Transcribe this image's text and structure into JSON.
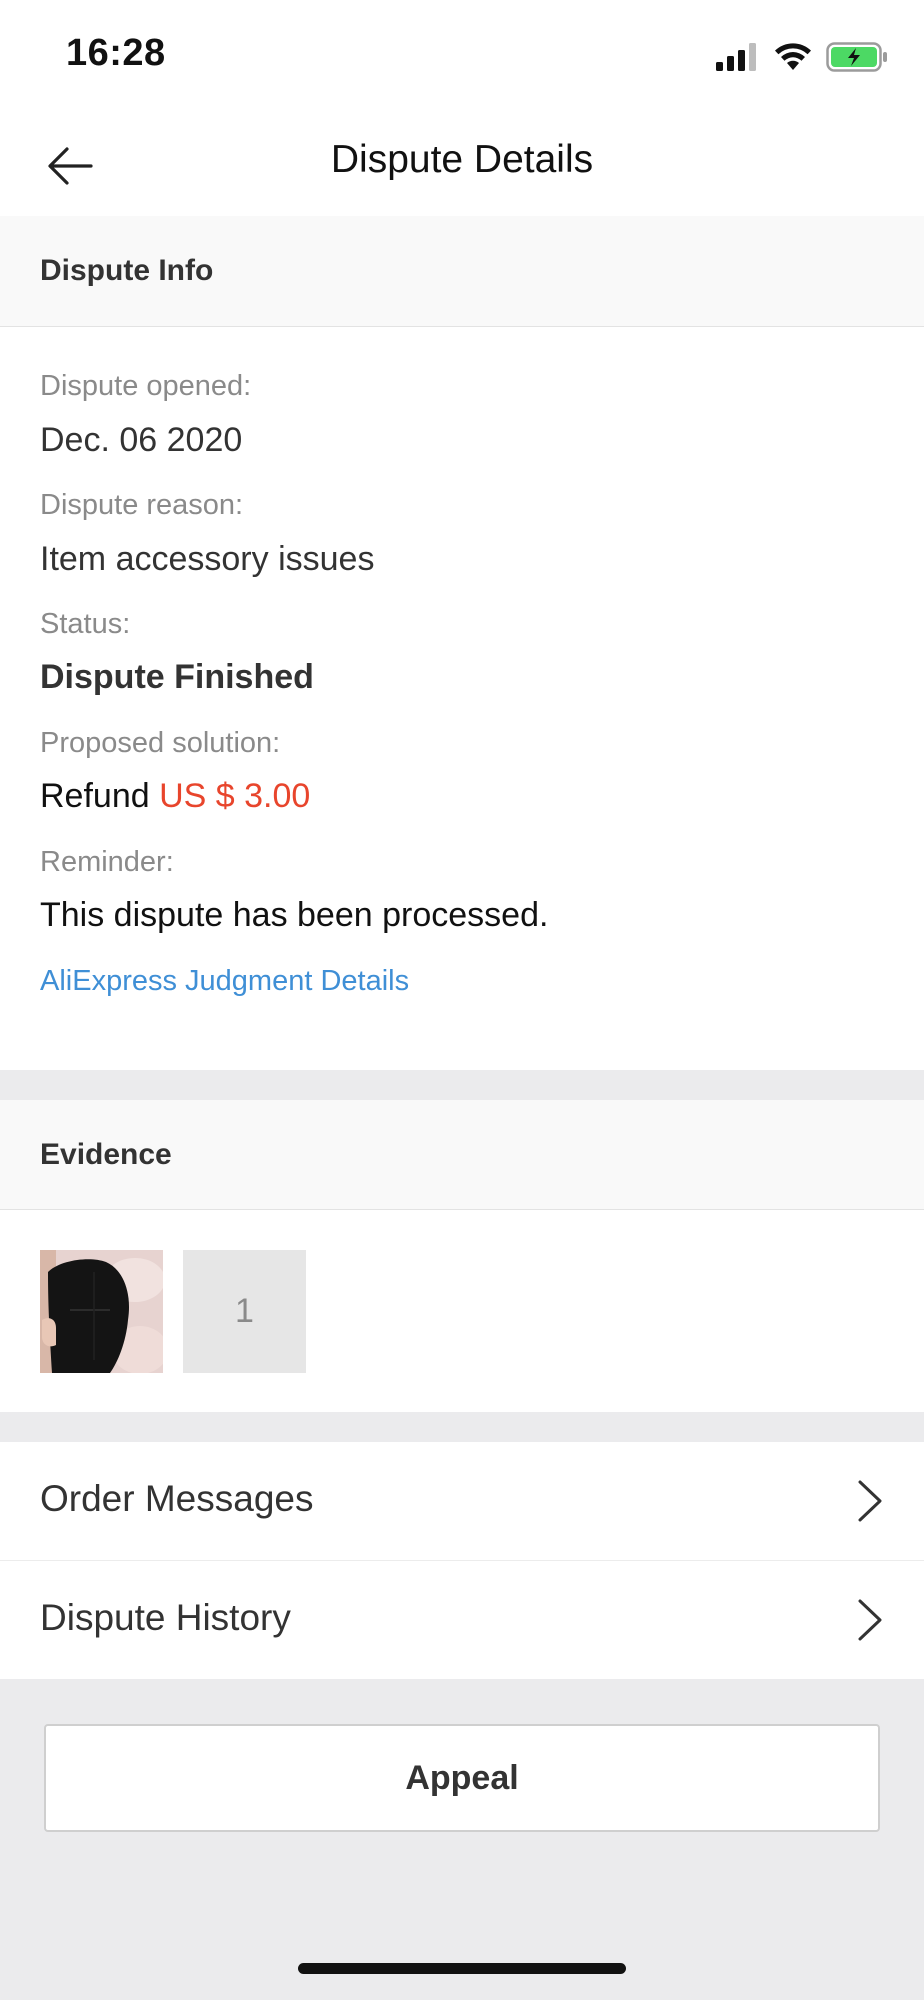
{
  "status_bar": {
    "time": "16:28"
  },
  "nav": {
    "title": "Dispute Details"
  },
  "dispute_info": {
    "header": "Dispute Info",
    "opened_label": "Dispute opened:",
    "opened_value": "Dec. 06 2020",
    "reason_label": "Dispute reason:",
    "reason_value": "Item accessory issues",
    "status_label": "Status:",
    "status_value": "Dispute Finished",
    "solution_label": "Proposed solution:",
    "solution_prefix": "Refund",
    "solution_amount": "US $ 3.00",
    "reminder_label": "Reminder:",
    "reminder_value": "This dispute has been processed.",
    "judgment_link": "AliExpress Judgment Details"
  },
  "evidence": {
    "header": "Evidence",
    "count_tile": "1"
  },
  "rows": {
    "order_messages": "Order Messages",
    "dispute_history": "Dispute History"
  },
  "actions": {
    "appeal_label": "Appeal"
  },
  "colors": {
    "price": "#e8452c",
    "link": "#3f8fd6",
    "battery": "#4cd964"
  }
}
